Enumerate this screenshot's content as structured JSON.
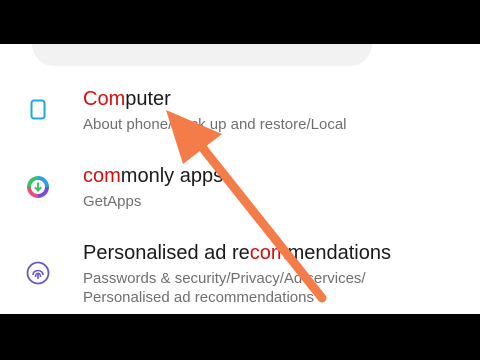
{
  "results": [
    {
      "icon": "tablet-icon",
      "title_highlight": "Com",
      "title_rest": "puter",
      "subtitle": "About phone/Back up and restore/Local"
    },
    {
      "icon": "getapps-icon",
      "title_highlight": "com",
      "title_rest": "monly apps",
      "subtitle": "GetApps"
    },
    {
      "icon": "fingerprint-icon",
      "title_lead": "Personalised ad re",
      "title_highlight": "com",
      "title_rest": "mendations",
      "subtitle_line1": "Passwords & security/Privacy/Ad services/",
      "subtitle_line2": "Personalised ad recommendations"
    }
  ],
  "colors": {
    "highlight": "#d40f0f",
    "accent_icon": "#1ea7e1",
    "arrow": "#f47c48"
  }
}
